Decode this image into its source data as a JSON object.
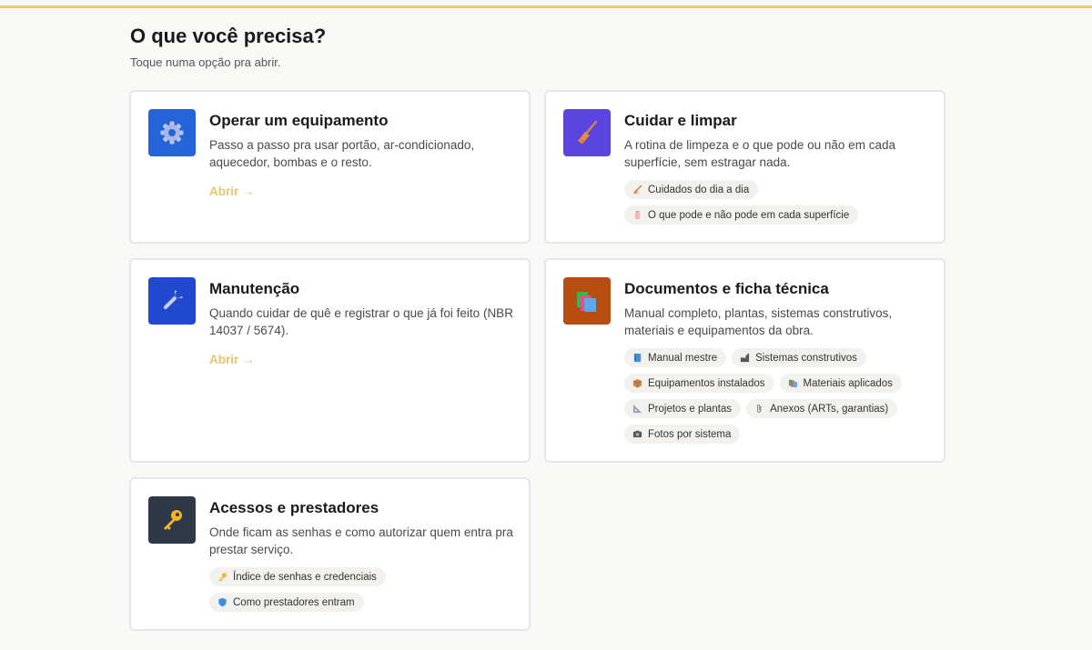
{
  "page": {
    "title": "O que você precisa?",
    "subtitle": "Toque numa opção pra abrir."
  },
  "cards": {
    "operar": {
      "title": "Operar um equipamento",
      "description": "Passo a passo pra usar portão, ar-condicionado, aquecedor, bombas e o resto.",
      "link": "Abrir →",
      "icon": "gear-icon",
      "color": "#2563d8"
    },
    "cuidar": {
      "title": "Cuidar e limpar",
      "description": "A rotina de limpeza e o que pode ou não em cada superfície, sem estragar nada.",
      "icon": "broom-icon",
      "color": "#5b45e0",
      "chips": [
        {
          "label": "Cuidados do dia a dia",
          "icon": "broom-icon"
        },
        {
          "label": "O que pode e não pode em cada superfície",
          "icon": "spray-bottle-icon"
        }
      ]
    },
    "manutencao": {
      "title": "Manutenção",
      "description": "Quando cuidar de quê e registrar o que já foi feito (NBR 14037 / 5674).",
      "link": "Abrir →",
      "icon": "wrench-icon",
      "color": "#2149d0"
    },
    "documentos": {
      "title": "Documentos e ficha técnica",
      "description": "Manual completo, plantas, sistemas construtivos, materiais e equipamentos da obra.",
      "icon": "books-icon",
      "color": "#b84d12",
      "chips": [
        {
          "label": "Manual mestre",
          "icon": "book-icon"
        },
        {
          "label": "Sistemas construtivos",
          "icon": "factory-icon"
        },
        {
          "label": "Equipamentos instalados",
          "icon": "package-icon"
        },
        {
          "label": "Materiais aplicados",
          "icon": "books-icon"
        },
        {
          "label": "Projetos e plantas",
          "icon": "triangle-ruler-icon"
        },
        {
          "label": "Anexos (ARTs, garantias)",
          "icon": "paperclip-icon"
        },
        {
          "label": "Fotos por sistema",
          "icon": "camera-icon"
        }
      ]
    },
    "acessos": {
      "title": "Acessos e prestadores",
      "description": "Onde ficam as senhas e como autorizar quem entra pra prestar serviço.",
      "icon": "key-icon",
      "color": "#2f3846",
      "chips": [
        {
          "label": "Índice de senhas e credenciais",
          "icon": "key-icon"
        },
        {
          "label": "Como prestadores entram",
          "icon": "shield-icon"
        }
      ]
    }
  }
}
